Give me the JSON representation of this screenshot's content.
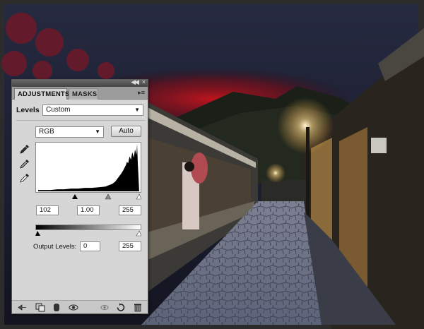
{
  "panel": {
    "tabs": [
      {
        "label": "ADJUSTMENTS",
        "active": true
      },
      {
        "label": "MASKS",
        "active": false
      }
    ],
    "collapse_icon": "double-chevron-left-icon",
    "close_icon": "close-icon",
    "menu_icon": "panel-menu-icon"
  },
  "levels": {
    "title": "Levels",
    "preset": "Custom",
    "channel": "RGB",
    "auto_label": "Auto",
    "input": {
      "black": "102",
      "gamma": "1.00",
      "white": "255"
    },
    "output_label": "Output Levels:",
    "output": {
      "black": "0",
      "white": "255"
    }
  },
  "bottom_icons": [
    "return-arrow-icon",
    "clip-to-layer-icon",
    "visibility-toggle-icon",
    "view-previous-icon",
    "reset-icon",
    "delete-icon"
  ],
  "colors": {
    "sky": "#1f2238",
    "red_glow": "#b01018",
    "lamp": "#ffe8b0"
  }
}
